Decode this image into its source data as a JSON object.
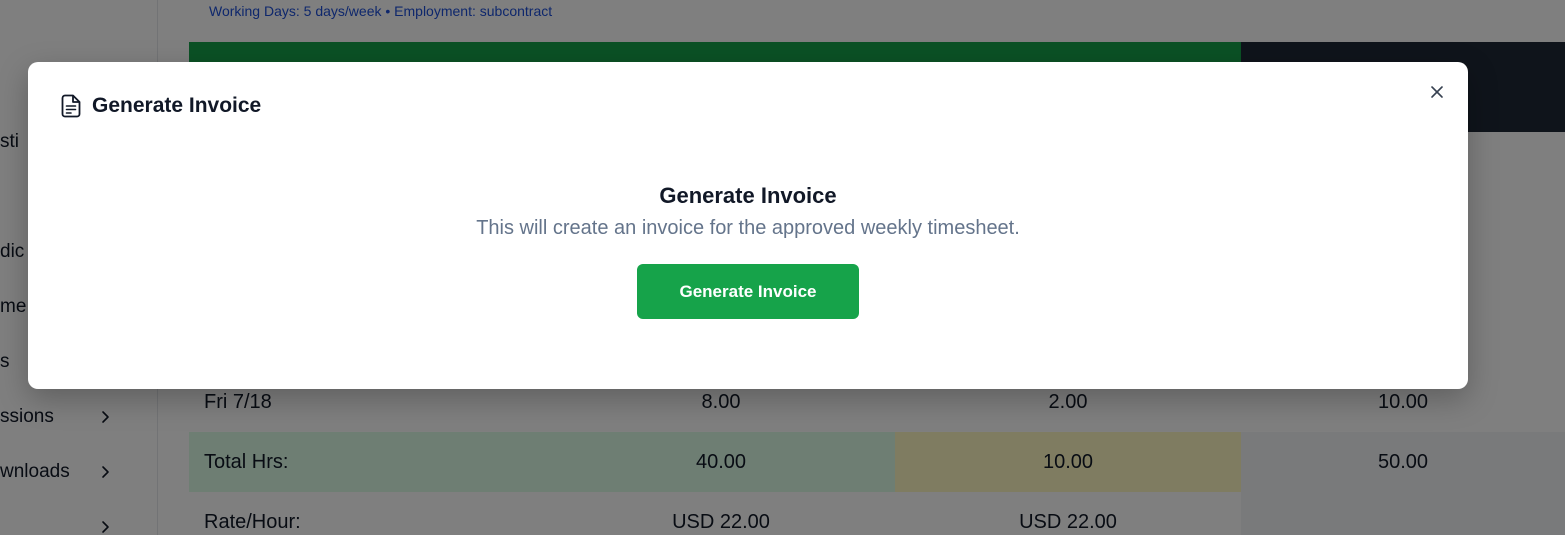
{
  "sidebar": {
    "items": [
      {
        "label": "sti"
      },
      {
        "label": "dic"
      },
      {
        "label": "me"
      },
      {
        "label": "s"
      },
      {
        "label": "ssions"
      },
      {
        "label": "wnloads"
      }
    ]
  },
  "page": {
    "info_line": "Working Days: 5 days/week • Employment: subcontract"
  },
  "table": {
    "rows": [
      {
        "label": "Fri 7/18",
        "regular": "8.00",
        "overtime": "2.00",
        "total": "10.00"
      },
      {
        "label": "Total Hrs:",
        "regular": "40.00",
        "overtime": "10.00",
        "total": "50.00"
      },
      {
        "label": "Rate/Hour:",
        "regular": "USD 22.00",
        "overtime": "USD 22.00",
        "total": ""
      }
    ]
  },
  "modal": {
    "title": "Generate Invoice",
    "heading": "Generate Invoice",
    "description": "This will create an invoice for the approved weekly timesheet.",
    "button_label": "Generate Invoice",
    "header_icon": "document-icon",
    "close_icon": "close-icon"
  },
  "colors": {
    "accent_green": "#16a34a",
    "overlay": "rgba(0,0,0,0.5)",
    "description_text": "#64748b"
  }
}
